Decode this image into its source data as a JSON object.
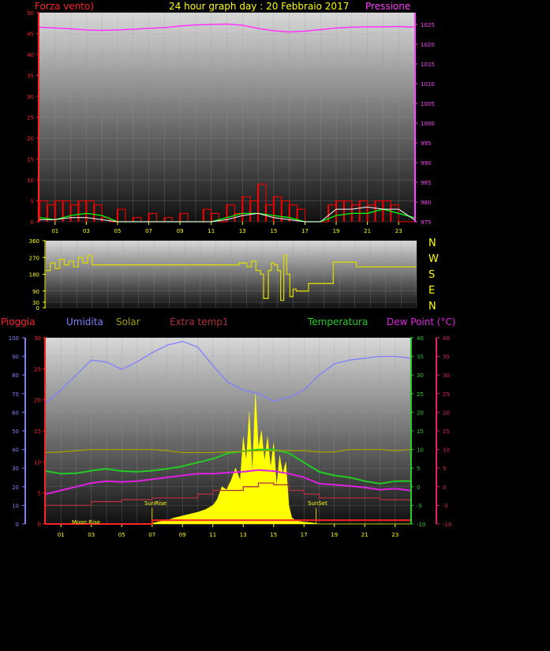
{
  "header": {
    "title": "24 hour graph day : 20 Febbraio 2017",
    "left_label": "Forza vento)",
    "right_label": "Pressione"
  },
  "colors": {
    "wind": "#ff0000",
    "gust": "#00ff00",
    "avg": "#ffffff",
    "pressure": "#ff33ff",
    "direction": "#d8d800",
    "rain": "#ff2222",
    "humidity": "#8080ff",
    "solar": "#ffff00",
    "solar_avg": "#a0a000",
    "extra_temp": "#b03040",
    "temperature": "#22cc22",
    "dewpoint": "#e020e0"
  },
  "bottom_labels": {
    "rain": "Pioggia",
    "humidity": "Umidita",
    "solar": "Solar",
    "extra_temp": "Extra temp1",
    "temperature": "Temperatura",
    "dewpoint": "Dew Point (°C)"
  },
  "compass": [
    "N",
    "W",
    "S",
    "E",
    "N"
  ],
  "annotations": {
    "sunrise": "SunRise",
    "sunset": "SunSet",
    "moonrise": "Moon Rise"
  },
  "chart_data": [
    {
      "type": "line",
      "title": "24 hour graph day : 20 Febbraio 2017",
      "x_ticks": [
        "01",
        "03",
        "05",
        "07",
        "09",
        "11",
        "13",
        "15",
        "17",
        "19",
        "21",
        "23"
      ],
      "y_left": {
        "label": "Forza vento)",
        "range": [
          0,
          50
        ],
        "ticks": [
          0,
          5,
          10,
          15,
          20,
          25,
          30,
          35,
          40,
          45,
          50
        ]
      },
      "y_right": {
        "label": "Pressione",
        "range": [
          975,
          1028
        ],
        "ticks": [
          975,
          980,
          985,
          990,
          995,
          1000,
          1005,
          1010,
          1015,
          1020,
          1025
        ]
      },
      "series": [
        {
          "name": "Pressione",
          "axis": "right",
          "x": [
            0,
            1,
            2,
            3,
            4,
            5,
            6,
            7,
            8,
            9,
            10,
            11,
            12,
            13,
            14,
            15,
            16,
            17,
            18,
            19,
            20,
            21,
            22,
            23,
            24
          ],
          "values": [
            1024.3,
            1024.1,
            1023.9,
            1023.6,
            1023.5,
            1023.6,
            1023.8,
            1024.0,
            1024.2,
            1024.6,
            1024.9,
            1025.0,
            1025.1,
            1024.8,
            1024.0,
            1023.4,
            1023.1,
            1023.3,
            1023.7,
            1024.1,
            1024.3,
            1024.4,
            1024.4,
            1024.5,
            1024.3
          ]
        },
        {
          "axis": "left",
          "kind": "wind",
          "x": [
            0,
            0.5,
            1,
            1.5,
            2,
            2.5,
            3,
            3.5,
            4,
            4.5,
            5,
            5.5,
            6,
            6.5,
            7,
            7.5,
            8,
            8.5,
            9,
            9.5,
            10,
            10.5,
            11,
            11.5,
            12,
            12.5,
            13,
            13.5,
            14,
            14.5,
            15,
            15.5,
            16,
            16.5,
            17,
            17.5,
            18,
            18.5,
            19,
            19.5,
            20,
            20.5,
            21,
            21.5,
            22,
            22.5,
            23,
            23.5,
            24
          ],
          "values": [
            5,
            4,
            5,
            5,
            4,
            5,
            5,
            4,
            1,
            0,
            3,
            0,
            1,
            0,
            2,
            0,
            1,
            0,
            2,
            0,
            0,
            3,
            2,
            0,
            4,
            2,
            6,
            5,
            9,
            4,
            6,
            5,
            4,
            3,
            0,
            0,
            0,
            4,
            5,
            5,
            4,
            5,
            4,
            5,
            5,
            4,
            0,
            0,
            0
          ]
        },
        {
          "axis": "left",
          "kind": "gust",
          "x": [
            0,
            1,
            2,
            3,
            4,
            5,
            6,
            7,
            8,
            9,
            10,
            11,
            12,
            13,
            14,
            15,
            16,
            17,
            18,
            19,
            20,
            21,
            22,
            23,
            24
          ],
          "values": [
            1,
            0.5,
            1.5,
            2,
            1.5,
            0,
            0,
            0,
            0,
            0,
            0,
            0,
            1,
            2,
            2,
            1.5,
            1,
            0,
            0,
            1.5,
            2,
            2,
            3,
            2,
            1
          ]
        },
        {
          "axis": "left",
          "kind": "avg",
          "x": [
            0,
            1,
            2,
            3,
            4,
            5,
            6,
            7,
            8,
            9,
            10,
            11,
            12,
            13,
            14,
            15,
            16,
            17,
            18,
            19,
            20,
            21,
            22,
            23,
            24
          ],
          "values": [
            0.5,
            0.5,
            1,
            1,
            0.5,
            0,
            0,
            0,
            0,
            0,
            0,
            0,
            0.5,
            1.5,
            2,
            1,
            0.5,
            0,
            0,
            3,
            3,
            3.5,
            3,
            3,
            0.5
          ]
        }
      ]
    },
    {
      "type": "line",
      "title": "",
      "x_ticks": [],
      "y_left": {
        "label": "",
        "range": [
          0,
          360
        ],
        "ticks": [
          0,
          30,
          90,
          180,
          270,
          360
        ]
      },
      "series": [
        {
          "kind": "direction",
          "x": [
            0,
            0.3,
            0.6,
            0.9,
            1.2,
            1.5,
            1.8,
            2.1,
            2.4,
            2.7,
            3.0,
            3.5,
            4,
            6,
            8,
            10,
            12,
            12.5,
            13,
            13.3,
            13.6,
            13.9,
            14.1,
            14.4,
            14.6,
            14.8,
            15.0,
            15.2,
            15.4,
            15.6,
            15.8,
            16.0,
            16.2,
            17,
            18,
            18.5,
            18.6,
            20,
            20.1,
            24
          ],
          "values": [
            200,
            240,
            210,
            260,
            230,
            250,
            220,
            270,
            240,
            280,
            230,
            230,
            230,
            230,
            230,
            230,
            230,
            240,
            220,
            250,
            200,
            180,
            50,
            200,
            240,
            230,
            200,
            40,
            280,
            180,
            60,
            100,
            90,
            130,
            130,
            130,
            245,
            245,
            220,
            220
          ]
        }
      ]
    },
    {
      "type": "line",
      "title": "",
      "x_ticks": [
        "01",
        "03",
        "05",
        "07",
        "09",
        "11",
        "13",
        "15",
        "17",
        "19",
        "21",
        "23"
      ],
      "y_left_rain": {
        "label": "Pioggia",
        "range": [
          0,
          30
        ],
        "ticks": [
          0,
          5,
          10,
          15,
          20,
          25,
          30
        ]
      },
      "y_left_hum": {
        "label": "Umidita",
        "range": [
          0,
          100
        ],
        "ticks": [
          0,
          10,
          20,
          30,
          40,
          50,
          60,
          70,
          80,
          90,
          100
        ]
      },
      "y_right_temp": {
        "label": "Temperatura",
        "range": [
          -10,
          40
        ],
        "ticks": [
          -10,
          -5,
          0,
          5,
          10,
          15,
          20,
          25,
          30,
          35,
          40
        ]
      },
      "y_right_dew": {
        "label": "Dew Point (°C)",
        "range": [
          -10,
          40
        ],
        "ticks": [
          -10,
          -5,
          0,
          5,
          10,
          15,
          20,
          25,
          30,
          35,
          40
        ]
      },
      "series": [
        {
          "name": "Umidita",
          "axis": "hum",
          "x": [
            0,
            1,
            2,
            3,
            4,
            5,
            6,
            7,
            8,
            9,
            10,
            11,
            12,
            13,
            14,
            15,
            16,
            17,
            18,
            19,
            20,
            21,
            22,
            23,
            24
          ],
          "values": [
            65,
            72,
            80,
            88,
            87,
            83,
            87,
            92,
            96,
            98,
            95,
            85,
            76,
            72,
            70,
            66,
            68,
            72,
            80,
            86,
            88,
            89,
            90,
            90,
            89
          ]
        },
        {
          "name": "Temperatura",
          "axis": "temp",
          "x": [
            0,
            1,
            2,
            3,
            4,
            5,
            6,
            7,
            8,
            9,
            10,
            11,
            12,
            13,
            14,
            15,
            16,
            17,
            18,
            19,
            20,
            21,
            22,
            23,
            24
          ],
          "values": [
            4.2,
            3.5,
            3.6,
            4.3,
            4.8,
            4.2,
            4.0,
            4.3,
            4.8,
            5.5,
            6.5,
            7.5,
            9.0,
            9.5,
            10.0,
            10.0,
            9.0,
            6.5,
            4.0,
            3.0,
            2.5,
            1.5,
            0.8,
            1.5,
            1.5
          ]
        },
        {
          "name": "Dew Point (°C)",
          "axis": "dew",
          "x": [
            0,
            1,
            2,
            3,
            4,
            5,
            6,
            7,
            8,
            9,
            10,
            11,
            12,
            13,
            14,
            15,
            16,
            17,
            18,
            19,
            20,
            21,
            22,
            23,
            24
          ],
          "values": [
            -2.0,
            -1.0,
            0.0,
            1.0,
            1.5,
            1.3,
            1.5,
            2.0,
            2.5,
            3.0,
            3.5,
            3.5,
            3.8,
            4.0,
            4.5,
            4.2,
            3.5,
            2.5,
            0.8,
            0.5,
            0.2,
            -0.2,
            -0.8,
            -0.5,
            -1.0
          ]
        },
        {
          "name": "Extra temp1",
          "axis": "dew",
          "x": [
            0,
            1,
            2,
            3,
            4,
            5,
            6,
            7,
            8,
            9,
            10,
            11,
            12,
            13,
            14,
            15,
            16,
            17,
            18,
            19,
            20,
            21,
            22,
            23,
            24
          ],
          "values": [
            -5,
            -5,
            -5,
            -4,
            -4,
            -3.5,
            -3.5,
            -3,
            -3,
            -3,
            -2,
            -1,
            -1,
            0,
            1,
            0.5,
            -1,
            -2,
            -3,
            -3,
            -3,
            -3,
            -3.5,
            -3.5,
            -3.5
          ]
        },
        {
          "name": "Solar",
          "axis": "rain",
          "kind": "solar_avg",
          "x": [
            0,
            1,
            2,
            3,
            4,
            5,
            6,
            7,
            8,
            9,
            10,
            11,
            12,
            13,
            14,
            15,
            16,
            17,
            18,
            19,
            20,
            21,
            22,
            23,
            24
          ],
          "values": [
            11.5,
            11.6,
            11.8,
            12.0,
            12.0,
            12.0,
            12.0,
            12.0,
            11.8,
            11.5,
            11.5,
            11.5,
            11.6,
            11.7,
            11.8,
            11.8,
            11.8,
            11.8,
            11.6,
            11.6,
            12.0,
            12.0,
            12.0,
            11.8,
            12.0
          ]
        },
        {
          "kind": "solar",
          "axis": "rain",
          "x": [
            0,
            6.8,
            7.5,
            8,
            8.5,
            9,
            9.5,
            10,
            10.5,
            11,
            11.3,
            11.6,
            11.9,
            12.2,
            12.5,
            12.8,
            13.0,
            13.2,
            13.4,
            13.6,
            13.8,
            14.0,
            14.2,
            14.4,
            14.6,
            14.8,
            15.0,
            15.2,
            15.4,
            15.6,
            15.8,
            16.0,
            16.2,
            16.5,
            17,
            17.5,
            18,
            24
          ],
          "values": [
            0,
            0,
            0.4,
            0.6,
            1.0,
            1.3,
            1.6,
            1.9,
            2.3,
            3.0,
            4.0,
            6.0,
            5.5,
            7.0,
            9.0,
            7.0,
            14.0,
            10.0,
            18.0,
            8.0,
            21.0,
            12.0,
            15.0,
            10.0,
            14.0,
            9.0,
            13.0,
            6.0,
            11.0,
            8.0,
            10.0,
            3.0,
            1.0,
            0.5,
            0.3,
            0.2,
            0,
            0
          ]
        },
        {
          "name": "Pioggia",
          "axis": "rain",
          "x": [
            0,
            6.5,
            7,
            24
          ],
          "values": [
            0,
            0,
            0.6,
            0.6
          ]
        }
      ]
    }
  ]
}
